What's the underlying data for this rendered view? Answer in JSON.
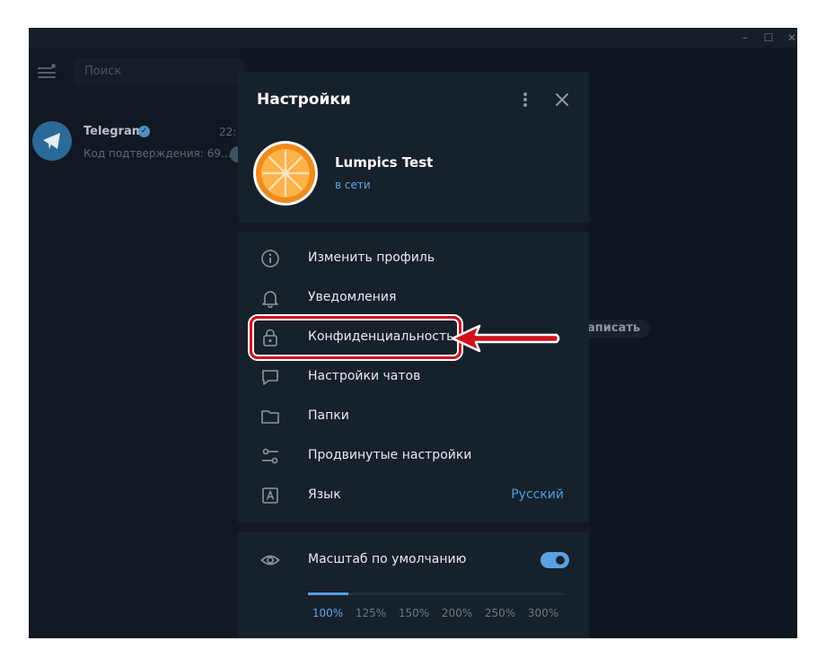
{
  "background_app": {
    "search": {
      "placeholder": "Поиск"
    },
    "chat": {
      "name": "Telegram",
      "time": "22:",
      "preview": "Код подтверждения: 69..."
    },
    "background_chip": "аписать"
  },
  "settings_dialog": {
    "title": "Настройки",
    "profile": {
      "name": "Lumpics Test",
      "status": "в сети"
    },
    "menu": [
      {
        "label": "Изменить профиль",
        "icon": "info-icon"
      },
      {
        "label": "Уведомления",
        "icon": "bell-icon"
      },
      {
        "label": "Конфиденциальность",
        "icon": "lock-icon"
      },
      {
        "label": "Настройки чатов",
        "icon": "chat-bubble-icon"
      },
      {
        "label": "Папки",
        "icon": "folder-icon"
      },
      {
        "label": "Продвинутые настройки",
        "icon": "sliders-icon"
      },
      {
        "label": "Язык",
        "icon": "language-icon",
        "value": "Русский"
      }
    ],
    "scale": {
      "label": "Масштаб по умолчанию",
      "toggle_on": true,
      "options": [
        "100%",
        "125%",
        "150%",
        "200%",
        "250%",
        "300%"
      ],
      "selected": "100%"
    }
  },
  "colors": {
    "accent": "#5aa1e0",
    "highlight": "#d0121b",
    "panel": "#17212b"
  }
}
